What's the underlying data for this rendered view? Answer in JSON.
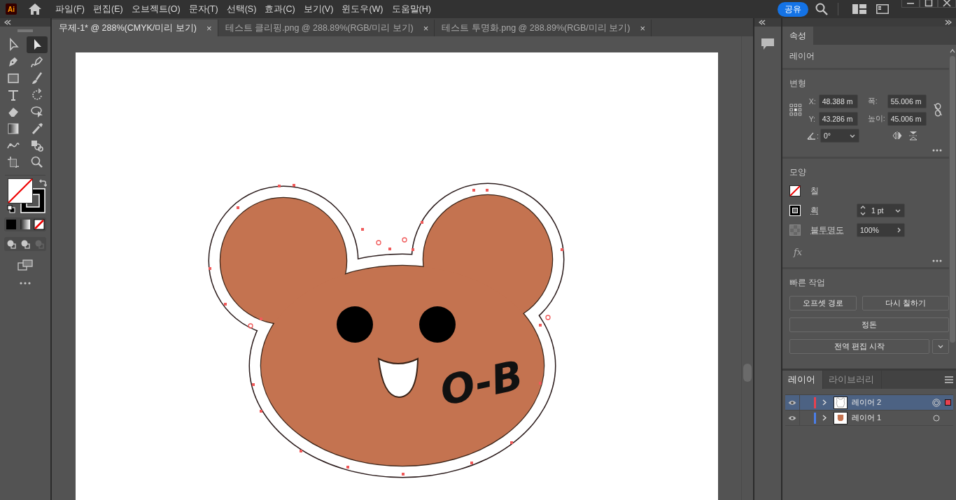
{
  "menu_bar": {
    "logo": "Ai",
    "items": [
      "파일(F)",
      "편집(E)",
      "오브젝트(O)",
      "문자(T)",
      "선택(S)",
      "효과(C)",
      "보기(V)",
      "윈도우(W)",
      "도움말(H)"
    ],
    "share_button": "공유"
  },
  "toolbar": {
    "tools": [
      {
        "selected": false
      },
      {
        "selected": true
      },
      {
        "selected": false
      },
      {
        "selected": false
      },
      {
        "selected": false
      },
      {
        "selected": false
      },
      {
        "selected": false
      },
      {
        "selected": false
      },
      {
        "selected": false
      },
      {
        "selected": false
      },
      {
        "selected": false
      },
      {
        "selected": false
      },
      {
        "selected": false
      },
      {
        "selected": false
      },
      {
        "selected": false
      },
      {
        "selected": false
      }
    ]
  },
  "document_tabs": [
    {
      "label": "무제-1* @ 288%(CMYK/미리 보기)",
      "selected": true,
      "close": "×"
    },
    {
      "label": "테스트 클리핑.png @ 288.89%(RGB/미리 보기)",
      "selected": false,
      "close": "×"
    },
    {
      "label": "테스트 투명화.png @ 288.89%(RGB/미리 보기)",
      "selected": false,
      "close": "×"
    }
  ],
  "canvas": {
    "artwork_text": "O-B"
  },
  "properties_panel": {
    "tab": {
      "label": "속성",
      "selected": true
    },
    "selection_label": "레이어",
    "transform": {
      "title": "변형",
      "fields": [
        {
          "label": "X:",
          "value": "48.388 m"
        },
        {
          "label": "폭:",
          "value": "55.006 m"
        },
        {
          "label": "Y:",
          "value": "43.286 m"
        },
        {
          "label": "높이:",
          "value": "45.006 m"
        }
      ],
      "angle_label": ":",
      "angle_value": "0°"
    },
    "appearance": {
      "title": "모양",
      "fill_label": "칠",
      "stroke_label": "획",
      "stroke_weight": "1 pt",
      "opacity_label": "불투명도",
      "opacity_value": "100%",
      "effects": "fx"
    },
    "quick_actions": {
      "title": "빠른 작업",
      "buttons": [
        "오프셋 경로",
        "다시 칠하기",
        "정돈",
        "전역 편집 시작"
      ]
    }
  },
  "layers_panel": {
    "tabs": [
      {
        "label": "레이어",
        "selected": true
      },
      {
        "label": "라이브러리",
        "selected": false
      }
    ],
    "layers": [
      {
        "name": "레이어 2",
        "color": "#e8414f",
        "selected": true,
        "visible": true
      },
      {
        "name": "레이어 1",
        "color": "#4a7ee8",
        "selected": false,
        "visible": true
      }
    ]
  }
}
